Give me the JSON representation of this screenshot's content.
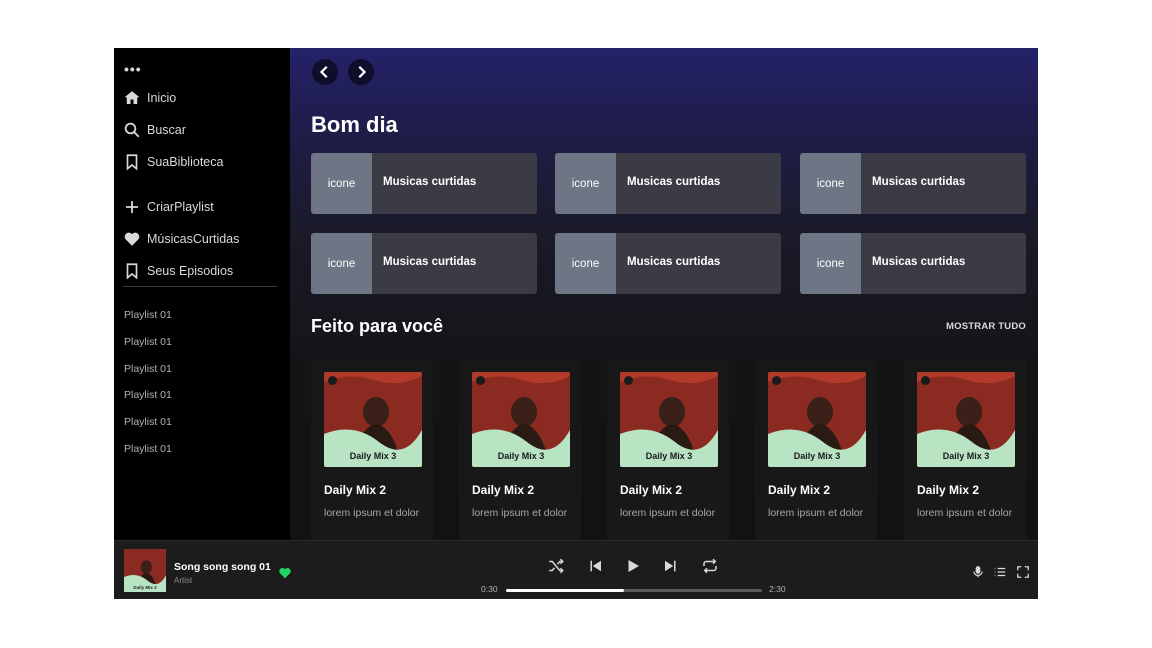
{
  "sidebar": {
    "menu_dots": "•••",
    "nav": [
      {
        "label": "Inicio",
        "icon": "home-icon"
      },
      {
        "label": "Buscar",
        "icon": "search-icon"
      },
      {
        "label": "SuaBiblioteca",
        "icon": "library-icon"
      }
    ],
    "actions": [
      {
        "label": "CriarPlaylist",
        "icon": "plus-icon"
      },
      {
        "label": "MúsicasCurtidas",
        "icon": "heart-icon"
      },
      {
        "label": "Seus Episodios",
        "icon": "bookmark-icon"
      }
    ],
    "playlists": [
      "Playlist 01",
      "Playlist 01",
      "Playlist 01",
      "Playlist 01",
      "Playlist 01",
      "Playlist 01"
    ]
  },
  "main": {
    "greeting": "Bom dia",
    "shortcuts": [
      {
        "thumb": "icone",
        "label": "Musicas curtidas"
      },
      {
        "thumb": "icone",
        "label": "Musicas curtidas"
      },
      {
        "thumb": "icone",
        "label": "Musicas curtidas"
      },
      {
        "thumb": "icone",
        "label": "Musicas curtidas"
      },
      {
        "thumb": "icone",
        "label": "Musicas curtidas"
      },
      {
        "thumb": "icone",
        "label": "Musicas curtidas"
      }
    ],
    "section_title": "Feito para você",
    "show_all": "MOSTRAR TUDO",
    "cards": [
      {
        "cover_title": "Daily Mix 3",
        "title": "Daily Mix 2",
        "desc": "lorem ipsum et dolor"
      },
      {
        "cover_title": "Daily Mix 3",
        "title": "Daily Mix 2",
        "desc": "lorem ipsum et dolor"
      },
      {
        "cover_title": "Daily Mix 3",
        "title": "Daily Mix 2",
        "desc": "lorem ipsum et dolor"
      },
      {
        "cover_title": "Daily Mix 3",
        "title": "Daily Mix 2",
        "desc": "lorem ipsum et dolor"
      },
      {
        "cover_title": "Daily Mix 3",
        "title": "Daily Mix 2",
        "desc": "lorem ipsum et dolor"
      }
    ]
  },
  "player": {
    "cover_title": "Daily Mix 3",
    "song_title": "Song song song 01",
    "artist": "Artist",
    "time_current": "0:30",
    "time_total": "2:30",
    "progress": 0.46,
    "accent_color": "#1ed760"
  }
}
